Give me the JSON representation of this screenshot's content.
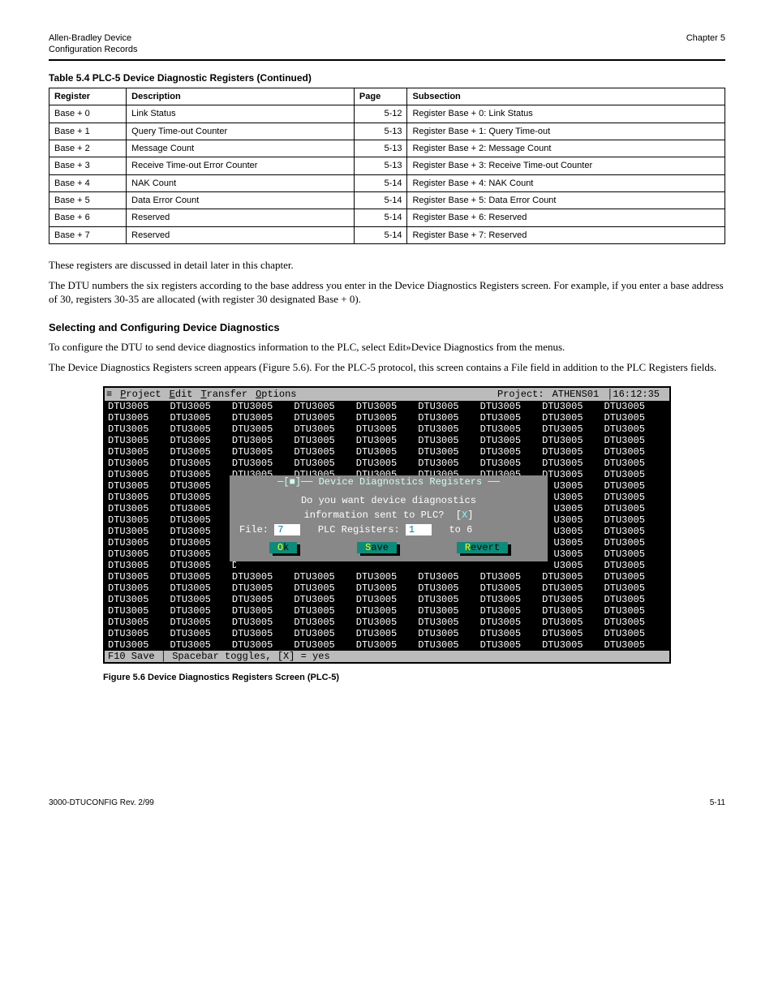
{
  "header": {
    "left_line1": "Allen-Bradley Device",
    "left_line2": "Configuration Records",
    "right": "Chapter 5"
  },
  "table_caption": "Table 5.4  PLC-5 Device Diagnostic Registers (Continued)",
  "reg_table": {
    "headers": [
      "Register",
      "Description",
      "Page",
      "Subsection"
    ],
    "rows": [
      [
        "Base + 0",
        "Link Status",
        "5-12",
        "Register Base + 0: Link Status"
      ],
      [
        "Base + 1",
        "Query Time-out Counter",
        "5-13",
        "Register Base + 1: Query Time-out"
      ],
      [
        "Base + 2",
        "Message Count",
        "5-13",
        "Register Base + 2: Message Count"
      ],
      [
        "Base + 3",
        "Receive Time-out Error Counter",
        "5-13",
        "Register Base + 3: Receive Time-out Counter"
      ],
      [
        "Base + 4",
        "NAK Count",
        "5-14",
        "Register Base + 4: NAK Count"
      ],
      [
        "Base + 5",
        "Data Error Count",
        "5-14",
        "Register Base + 5: Data Error Count"
      ],
      [
        "Base + 6",
        "Reserved",
        "5-14",
        "Register Base + 6: Reserved"
      ],
      [
        "Base + 7",
        "Reserved",
        "5-14",
        "Register Base + 7: Reserved"
      ]
    ]
  },
  "paragraphs": [
    "These registers are discussed in detail later in this chapter.",
    "The DTU numbers the six registers according to the base address you enter in the Device Diagnostics Registers screen. For example, if you enter a base address of 30, registers 30-35 are allocated (with register 30 designated Base + 0)."
  ],
  "section_heading": "Selecting and Configuring Device Diagnostics",
  "paragraphs2": [
    "To configure the DTU to send device diagnostics information to the PLC, select Edit»Device Diagnostics from the menus.",
    "The Device Diagnostics Registers screen appears (Figure 5.6). For the PLC-5 protocol, this screen contains a File field in addition to the PLC Registers fields."
  ],
  "terminal": {
    "menu": [
      "≡",
      "Project",
      "Edit",
      "Transfer",
      "Options"
    ],
    "project_label": "Project:",
    "project_name": "ATHENS01",
    "clock": "16:12:35",
    "bg_word": "DTU3005",
    "status_left": "F10 Save",
    "status_rest": " │ Spacebar toggles, [X] = yes",
    "dialog": {
      "title": "─[■]── Device Diagnostics Registers ──",
      "q1": "Do you want device diagnostics",
      "q2": "information sent to PLC?  [",
      "chk": "X",
      "q2_close": "]",
      "file_label": "File: ",
      "file_val": "7",
      "regs_label": "   PLC Registers: ",
      "reg_from": "1",
      "regs_to_label": "   to ",
      "reg_to": "6",
      "btn_ok": "Ok",
      "btn_save": "Save",
      "btn_revert": "Revert"
    }
  },
  "figure_caption": "Figure 5.6  Device Diagnostics Registers Screen (PLC-5)",
  "footer": {
    "left": "3000-DTUCONFIG   Rev. 2/99",
    "right": "5-11"
  }
}
